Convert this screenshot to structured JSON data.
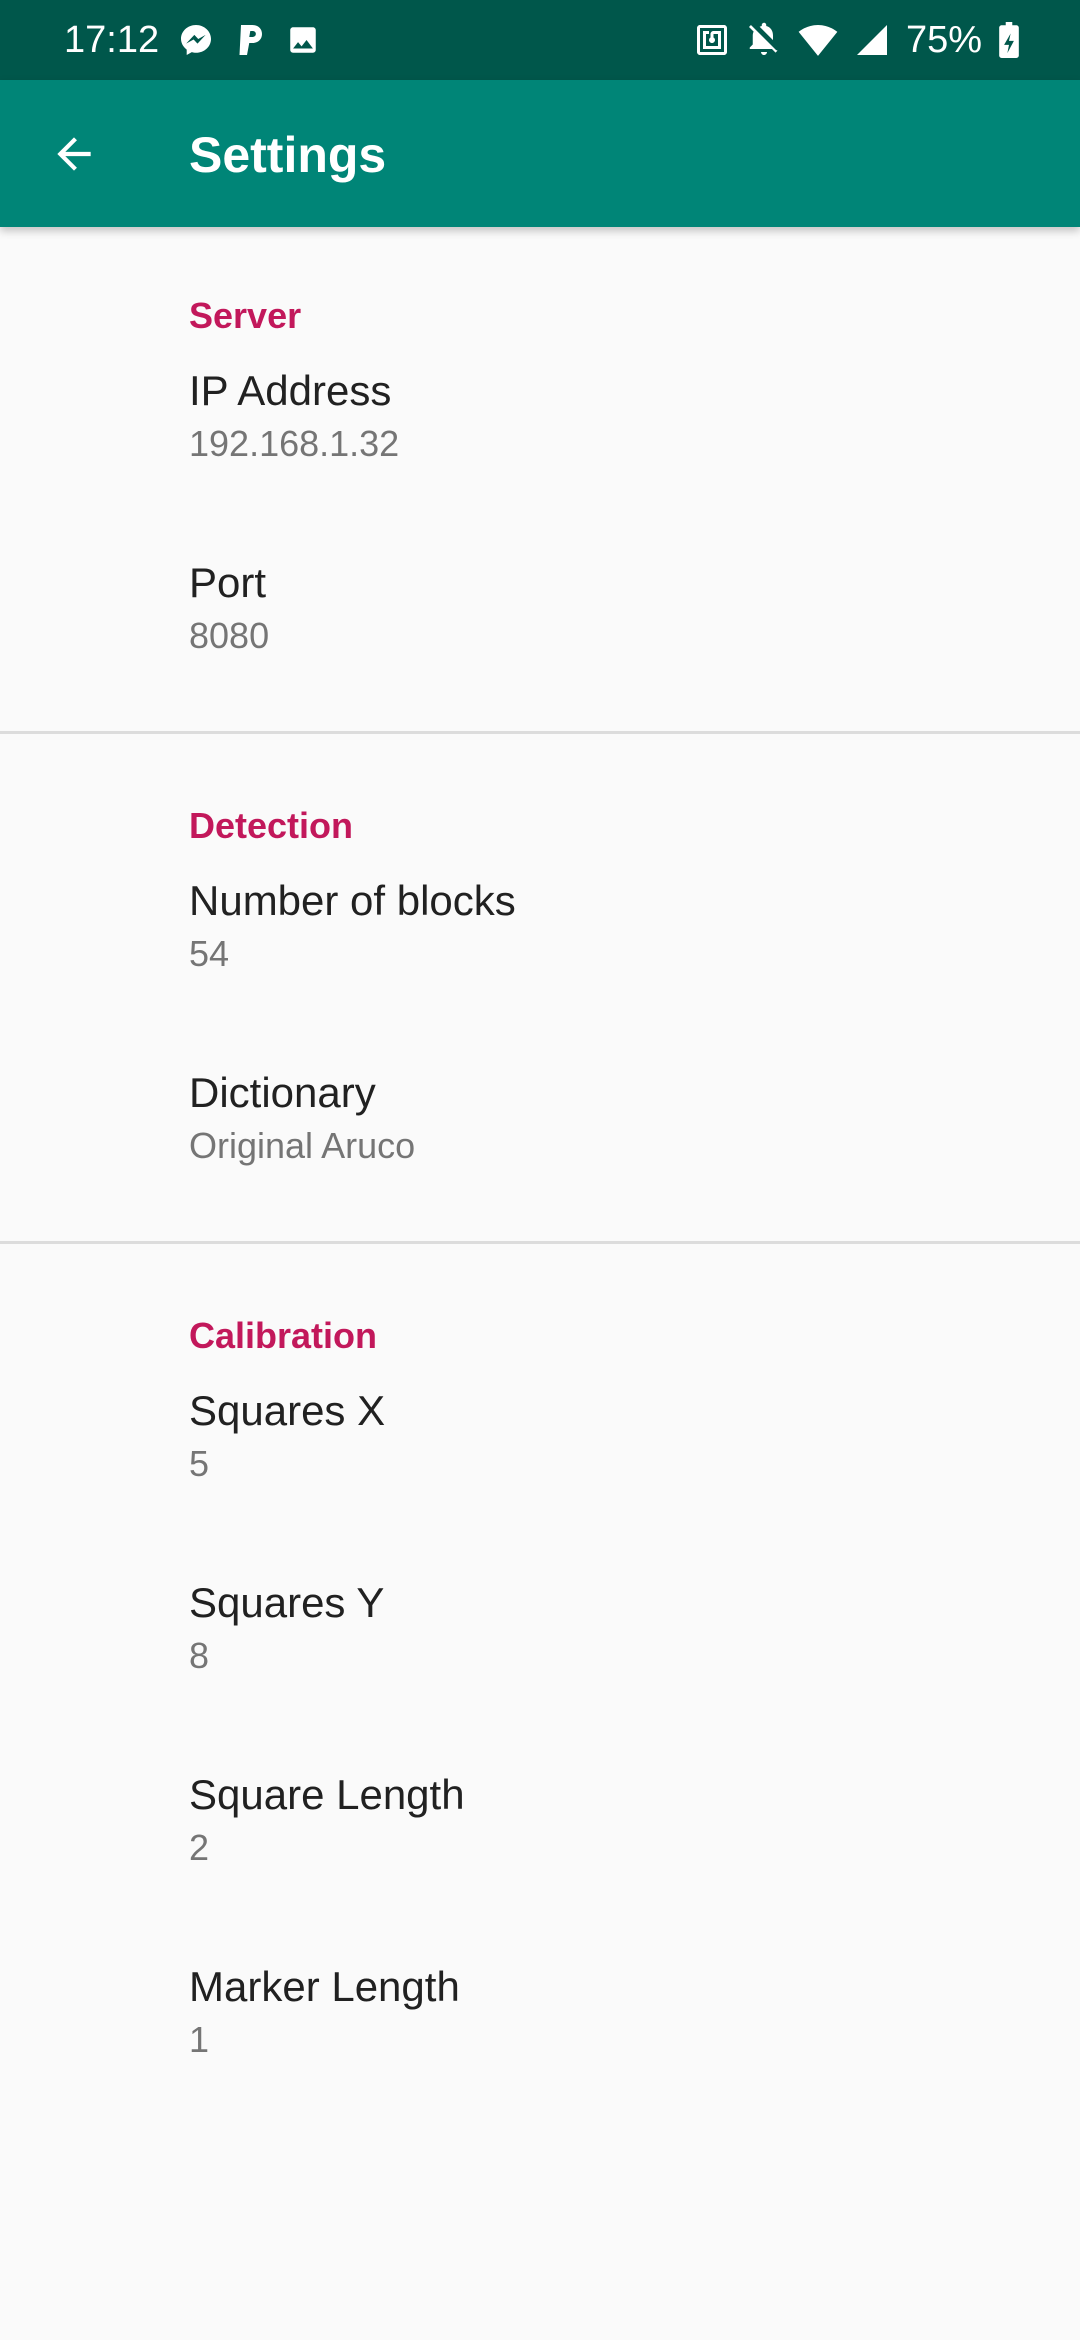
{
  "status_bar": {
    "time": "17:12",
    "battery_percent": "75%",
    "left_icons": [
      "messenger-icon",
      "p-app-icon",
      "image-icon"
    ],
    "right_icons": [
      "nfc-icon",
      "notifications-off-icon",
      "wifi-icon",
      "cell-signal-icon",
      "battery-icon"
    ]
  },
  "app_bar": {
    "title": "Settings",
    "back_icon": "arrow-back-icon"
  },
  "colors": {
    "status_bar": "#00574b",
    "app_bar": "#008577",
    "accent": "#c2185b",
    "background": "#fafafa",
    "primary_text": "#212121",
    "secondary_text": "#757575"
  },
  "categories": [
    {
      "title": "Server",
      "items": [
        {
          "title": "IP Address",
          "summary": "192.168.1.32"
        },
        {
          "title": "Port",
          "summary": "8080"
        }
      ]
    },
    {
      "title": "Detection",
      "items": [
        {
          "title": "Number of blocks",
          "summary": "54"
        },
        {
          "title": "Dictionary",
          "summary": "Original Aruco"
        }
      ]
    },
    {
      "title": "Calibration",
      "items": [
        {
          "title": "Squares X",
          "summary": "5"
        },
        {
          "title": "Squares Y",
          "summary": "8"
        },
        {
          "title": "Square Length",
          "summary": "2"
        },
        {
          "title": "Marker Length",
          "summary": "1"
        }
      ]
    }
  ]
}
